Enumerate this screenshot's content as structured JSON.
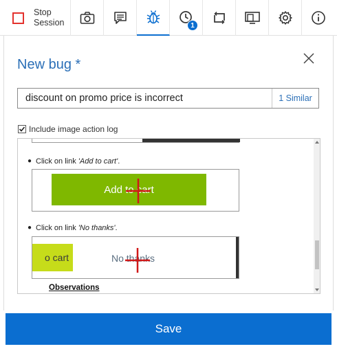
{
  "toolbar": {
    "stop_label": "Stop\nSession",
    "icons": [
      "camera-icon",
      "note-icon",
      "bug-icon",
      "history-icon",
      "crop-icon",
      "cast-icon",
      "gear-icon",
      "info-icon"
    ],
    "history_badge": "1"
  },
  "dialog": {
    "title": "New bug *",
    "bug_title_value": "discount on promo price is incorrect",
    "similar_label": "1 Similar",
    "include_log_label": "Include image action log"
  },
  "log": {
    "steps": [
      {
        "prefix": "Click on link ",
        "link": "'Add to cart'",
        "suffix": ".",
        "screenshot_text": "Add to cart"
      },
      {
        "prefix": "Click on link ",
        "link": "'No thanks'",
        "suffix": ".",
        "screenshot_text": "No thanks",
        "side_text": "o cart"
      }
    ],
    "observations_label": "Observations"
  },
  "save_label": "Save",
  "colors": {
    "accent": "#0b6ed0",
    "stop": "#e3312d",
    "green": "#7fb800",
    "lime": "#c6dc1a",
    "marker": "#d01818"
  }
}
